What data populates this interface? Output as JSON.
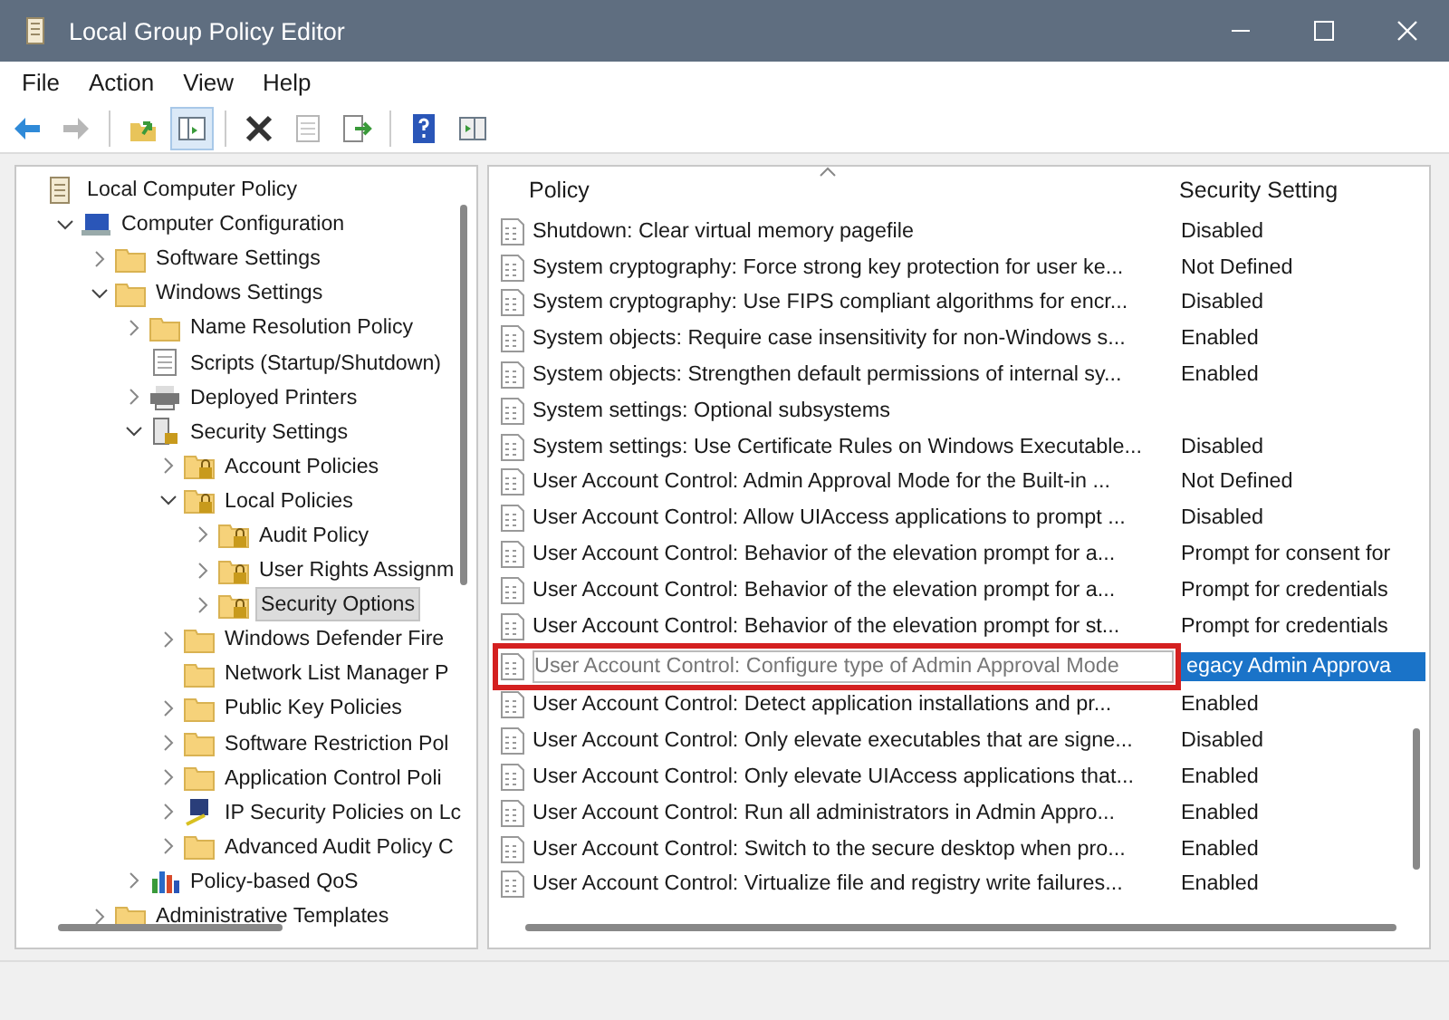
{
  "window": {
    "title": "Local Group Policy Editor"
  },
  "menu": [
    "File",
    "Action",
    "View",
    "Help"
  ],
  "toolbar": [
    {
      "kind": "back",
      "disabled": false
    },
    {
      "kind": "forward",
      "disabled": true
    },
    {
      "kind": "sep"
    },
    {
      "kind": "up",
      "disabled": false
    },
    {
      "kind": "tree",
      "disabled": false,
      "selected": true
    },
    {
      "kind": "sep"
    },
    {
      "kind": "delete",
      "disabled": false
    },
    {
      "kind": "properties",
      "disabled": true
    },
    {
      "kind": "export",
      "disabled": false
    },
    {
      "kind": "sep"
    },
    {
      "kind": "help",
      "disabled": false
    },
    {
      "kind": "pane",
      "disabled": false
    }
  ],
  "tree": [
    {
      "label": "Local Computer Policy",
      "kind": "doc",
      "selected": false,
      "children": [
        {
          "label": "Computer Configuration",
          "kind": "computer",
          "expanded": true,
          "selected": false,
          "children": [
            {
              "label": "Software Settings",
              "kind": "folder",
              "expanded": false,
              "selected": false
            },
            {
              "label": "Windows Settings",
              "kind": "folder",
              "expanded": true,
              "selected": false,
              "children": [
                {
                  "label": "Name Resolution Policy",
                  "kind": "folder",
                  "expanded": false,
                  "selected": false
                },
                {
                  "label": "Scripts (Startup/Shutdown)",
                  "kind": "scripts",
                  "selected": false
                },
                {
                  "label": "Deployed Printers",
                  "kind": "printer",
                  "expanded": false,
                  "selected": false
                },
                {
                  "label": "Security Settings",
                  "kind": "security",
                  "expanded": true,
                  "selected": false,
                  "children": [
                    {
                      "label": "Account Policies",
                      "kind": "lockfolder",
                      "expanded": false,
                      "selected": false
                    },
                    {
                      "label": "Local Policies",
                      "kind": "lockfolder",
                      "expanded": true,
                      "selected": false,
                      "children": [
                        {
                          "label": "Audit Policy",
                          "kind": "lockfolder",
                          "expanded": false,
                          "selected": false
                        },
                        {
                          "label": "User Rights Assignm",
                          "kind": "lockfolder",
                          "expanded": false,
                          "selected": false
                        },
                        {
                          "label": "Security Options",
                          "kind": "lockfolder",
                          "expanded": false,
                          "selected": true
                        }
                      ]
                    },
                    {
                      "label": "Windows Defender Fire",
                      "kind": "folder",
                      "expanded": false,
                      "selected": false
                    },
                    {
                      "label": "Network List Manager P",
                      "kind": "folder",
                      "selected": false
                    },
                    {
                      "label": "Public Key Policies",
                      "kind": "folder",
                      "expanded": false,
                      "selected": false
                    },
                    {
                      "label": "Software Restriction Pol",
                      "kind": "folder",
                      "expanded": false,
                      "selected": false
                    },
                    {
                      "label": "Application Control Poli",
                      "kind": "folder",
                      "expanded": false,
                      "selected": false
                    },
                    {
                      "label": "IP Security Policies on Lc",
                      "kind": "network",
                      "expanded": false,
                      "selected": false
                    },
                    {
                      "label": "Advanced Audit Policy C",
                      "kind": "folder",
                      "expanded": false,
                      "selected": false
                    }
                  ]
                },
                {
                  "label": "Policy-based QoS",
                  "kind": "chart",
                  "expanded": false,
                  "selected": false
                }
              ]
            },
            {
              "label": "Administrative Templates",
              "kind": "folder",
              "expanded": false,
              "selected": false
            }
          ]
        }
      ]
    }
  ],
  "table": {
    "columns": [
      "Policy",
      "Security Setting"
    ],
    "rows": [
      {
        "policy": "Shutdown: Clear virtual memory pagefile",
        "setting": "Disabled",
        "selected": false
      },
      {
        "policy": "System cryptography: Force strong key protection for user ke...",
        "setting": "Not Defined",
        "selected": false
      },
      {
        "policy": "System cryptography: Use FIPS compliant algorithms for encr...",
        "setting": "Disabled",
        "selected": false
      },
      {
        "policy": "System objects: Require case insensitivity for non-Windows s...",
        "setting": "Enabled",
        "selected": false
      },
      {
        "policy": "System objects: Strengthen default permissions of internal sy...",
        "setting": "Enabled",
        "selected": false
      },
      {
        "policy": "System settings: Optional subsystems",
        "selected": false
      },
      {
        "policy": "System settings: Use Certificate Rules on Windows Executable...",
        "setting": "Disabled",
        "selected": false
      },
      {
        "policy": "User Account Control: Admin Approval Mode for the Built-in ...",
        "setting": "Not Defined",
        "selected": false
      },
      {
        "policy": "User Account Control: Allow UIAccess applications to prompt ...",
        "setting": "Disabled",
        "selected": false
      },
      {
        "policy": "User Account Control: Behavior of the elevation prompt for a...",
        "setting": "Prompt for consent for",
        "selected": false
      },
      {
        "policy": "User Account Control: Behavior of the elevation prompt for a...",
        "setting": "Prompt for credentials",
        "selected": false
      },
      {
        "policy": "User Account Control: Behavior of the elevation prompt for st...",
        "setting": "Prompt for credentials",
        "selected": false
      },
      {
        "policy": "User Account Control: Configure type of Admin Approval Mode",
        "setting": "egacy Admin Approva",
        "selected": true,
        "highlighted": true
      },
      {
        "policy": "User Account Control: Detect application installations and pr...",
        "setting": "Enabled",
        "selected": false
      },
      {
        "policy": "User Account Control: Only elevate executables that are signe...",
        "setting": "Disabled",
        "selected": false
      },
      {
        "policy": "User Account Control: Only elevate UIAccess applications that...",
        "setting": "Enabled",
        "selected": false
      },
      {
        "policy": "User Account Control: Run all administrators in Admin Appro...",
        "setting": "Enabled",
        "selected": false
      },
      {
        "policy": "User Account Control: Switch to the secure desktop when pro...",
        "setting": "Enabled",
        "selected": false
      },
      {
        "policy": "User Account Control: Virtualize file and registry write failures...",
        "setting": "Enabled",
        "selected": false
      }
    ]
  }
}
